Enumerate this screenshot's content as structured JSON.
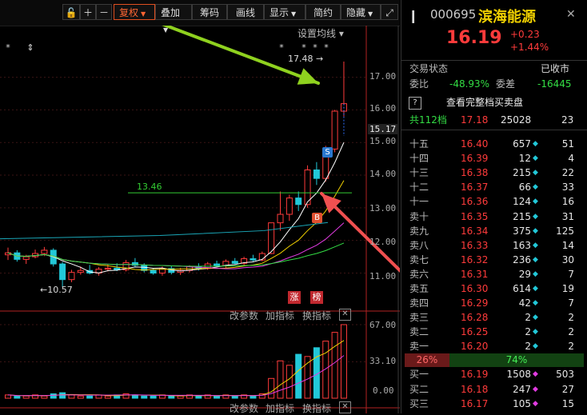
{
  "toolbar": {
    "buttons": [
      "复权",
      "叠加",
      "筹码",
      "画线",
      "显示",
      "简约",
      "隐藏"
    ],
    "selected": "复权"
  },
  "main_chart": {
    "settings_label": "设置均线",
    "high_marker": "17.48",
    "low_marker": "10.57",
    "level_line_label": "13.46",
    "y_ticks": [
      "17.00",
      "16.00",
      "15.17",
      "15.00",
      "14.00",
      "13.00",
      "12.00",
      "11.00"
    ],
    "badges": {
      "zhang": "涨",
      "bang": "榜",
      "sell": "S",
      "buy": "B"
    }
  },
  "sub_chart": {
    "controls": [
      "改参数",
      "加指标",
      "换指标"
    ],
    "close_label": "⊠",
    "y_ticks": [
      "67.00",
      "33.10",
      "0.00"
    ]
  },
  "bottom_controls": [
    "改参数",
    "加指标",
    "换指标"
  ],
  "quote": {
    "code": "000695",
    "name": "滨海能源",
    "price": "16.19",
    "change": "+0.23",
    "change_pct": "+1.44%",
    "status_label": "交易状态",
    "status_value": "已收市",
    "ratio_label": "委比",
    "ratio_value": "-48.93%",
    "diff_label": "委差",
    "diff_value": "-16445",
    "full_book_link": "查看完整档买卖盘",
    "levels_label": "共112档",
    "levels_price": "17.18",
    "levels_vol": "25028",
    "levels_cnt": "23",
    "sell_rows": [
      {
        "label": "十五",
        "price": "16.40",
        "vol": "657",
        "cnt": "51"
      },
      {
        "label": "十四",
        "price": "16.39",
        "vol": "12",
        "cnt": "4"
      },
      {
        "label": "十三",
        "price": "16.38",
        "vol": "215",
        "cnt": "22"
      },
      {
        "label": "十二",
        "price": "16.37",
        "vol": "66",
        "cnt": "33"
      },
      {
        "label": "十一",
        "price": "16.36",
        "vol": "124",
        "cnt": "16"
      },
      {
        "label": "卖十",
        "price": "16.35",
        "vol": "215",
        "cnt": "31"
      },
      {
        "label": "卖九",
        "price": "16.34",
        "vol": "375",
        "cnt": "125"
      },
      {
        "label": "卖八",
        "price": "16.33",
        "vol": "163",
        "cnt": "14"
      },
      {
        "label": "卖七",
        "price": "16.32",
        "vol": "236",
        "cnt": "30"
      },
      {
        "label": "卖六",
        "price": "16.31",
        "vol": "29",
        "cnt": "7"
      },
      {
        "label": "卖五",
        "price": "16.30",
        "vol": "614",
        "cnt": "19"
      },
      {
        "label": "卖四",
        "price": "16.29",
        "vol": "42",
        "cnt": "7"
      },
      {
        "label": "卖三",
        "price": "16.28",
        "vol": "2",
        "cnt": "2"
      },
      {
        "label": "卖二",
        "price": "16.25",
        "vol": "2",
        "cnt": "2"
      },
      {
        "label": "卖一",
        "price": "16.20",
        "vol": "2",
        "cnt": "2"
      }
    ],
    "balance_left": "26%",
    "balance_right": "74%",
    "buy_rows": [
      {
        "label": "买一",
        "price": "16.19",
        "vol": "1508",
        "cnt": "503"
      },
      {
        "label": "买二",
        "price": "16.18",
        "vol": "247",
        "cnt": "27"
      },
      {
        "label": "买三",
        "price": "16.17",
        "vol": "105",
        "cnt": "15"
      }
    ]
  },
  "colors": {
    "up": "#ff3b3b",
    "down": "#22c8d8",
    "ma5": "#ffffff",
    "ma10": "#f0d000",
    "ma20": "#e23be2",
    "ma60": "#33dd44",
    "level": "#33cc33",
    "arrow_green": "#8fd11f",
    "arrow_red": "#f05050"
  },
  "chart_data": {
    "type": "candlestick",
    "ylim": [
      10.4,
      17.7
    ],
    "candles": [
      {
        "o": 11.56,
        "h": 11.78,
        "l": 11.4,
        "c": 11.62
      },
      {
        "o": 11.62,
        "h": 11.7,
        "l": 11.35,
        "c": 11.42
      },
      {
        "o": 11.42,
        "h": 11.56,
        "l": 11.28,
        "c": 11.5
      },
      {
        "o": 11.5,
        "h": 11.72,
        "l": 11.45,
        "c": 11.6
      },
      {
        "o": 11.6,
        "h": 11.8,
        "l": 11.52,
        "c": 11.7
      },
      {
        "o": 11.7,
        "h": 11.76,
        "l": 11.2,
        "c": 11.28
      },
      {
        "o": 11.28,
        "h": 11.34,
        "l": 10.57,
        "c": 10.8
      },
      {
        "o": 10.8,
        "h": 11.1,
        "l": 10.72,
        "c": 11.02
      },
      {
        "o": 11.02,
        "h": 11.2,
        "l": 10.95,
        "c": 11.08
      },
      {
        "o": 11.08,
        "h": 11.25,
        "l": 10.96,
        "c": 11.0
      },
      {
        "o": 11.0,
        "h": 11.18,
        "l": 10.92,
        "c": 11.12
      },
      {
        "o": 11.12,
        "h": 11.26,
        "l": 11.05,
        "c": 11.15
      },
      {
        "o": 11.15,
        "h": 11.3,
        "l": 11.06,
        "c": 11.1
      },
      {
        "o": 11.1,
        "h": 11.4,
        "l": 11.05,
        "c": 11.32
      },
      {
        "o": 11.32,
        "h": 11.46,
        "l": 11.2,
        "c": 11.24
      },
      {
        "o": 11.24,
        "h": 11.3,
        "l": 11.02,
        "c": 11.08
      },
      {
        "o": 11.08,
        "h": 11.16,
        "l": 10.95,
        "c": 11.0
      },
      {
        "o": 11.0,
        "h": 11.2,
        "l": 10.92,
        "c": 11.14
      },
      {
        "o": 11.14,
        "h": 11.22,
        "l": 10.96,
        "c": 11.02
      },
      {
        "o": 11.02,
        "h": 11.16,
        "l": 10.94,
        "c": 11.08
      },
      {
        "o": 11.08,
        "h": 11.24,
        "l": 11.02,
        "c": 11.2
      },
      {
        "o": 11.2,
        "h": 11.3,
        "l": 11.08,
        "c": 11.14
      },
      {
        "o": 11.14,
        "h": 11.34,
        "l": 11.1,
        "c": 11.28
      },
      {
        "o": 11.28,
        "h": 11.38,
        "l": 11.18,
        "c": 11.22
      },
      {
        "o": 11.22,
        "h": 11.42,
        "l": 11.16,
        "c": 11.36
      },
      {
        "o": 11.36,
        "h": 11.46,
        "l": 11.26,
        "c": 11.3
      },
      {
        "o": 11.3,
        "h": 11.5,
        "l": 11.24,
        "c": 11.44
      },
      {
        "o": 11.44,
        "h": 11.56,
        "l": 11.36,
        "c": 11.4
      },
      {
        "o": 11.4,
        "h": 11.66,
        "l": 11.36,
        "c": 11.6
      },
      {
        "o": 11.6,
        "h": 12.54,
        "l": 11.58,
        "c": 12.54
      },
      {
        "o": 12.54,
        "h": 13.5,
        "l": 12.3,
        "c": 12.8
      },
      {
        "o": 12.8,
        "h": 13.4,
        "l": 12.6,
        "c": 13.3
      },
      {
        "o": 13.3,
        "h": 13.5,
        "l": 12.9,
        "c": 13.1
      },
      {
        "o": 13.1,
        "h": 14.3,
        "l": 13.0,
        "c": 14.16
      },
      {
        "o": 14.16,
        "h": 14.4,
        "l": 13.7,
        "c": 13.9
      },
      {
        "o": 13.9,
        "h": 14.9,
        "l": 13.8,
        "c": 14.8
      },
      {
        "o": 14.8,
        "h": 16.0,
        "l": 14.7,
        "c": 15.96
      },
      {
        "o": 15.96,
        "h": 17.48,
        "l": 15.8,
        "c": 16.19
      }
    ],
    "level": 13.46,
    "volume_ylim": [
      0,
      67
    ],
    "volumes": [
      3,
      2,
      2,
      3,
      2,
      4,
      5,
      3,
      2,
      2,
      3,
      2,
      3,
      4,
      3,
      2,
      2,
      3,
      2,
      2,
      3,
      2,
      3,
      2,
      3,
      2,
      3,
      2,
      4,
      18,
      34,
      30,
      40,
      38,
      46,
      52,
      60,
      67
    ]
  }
}
